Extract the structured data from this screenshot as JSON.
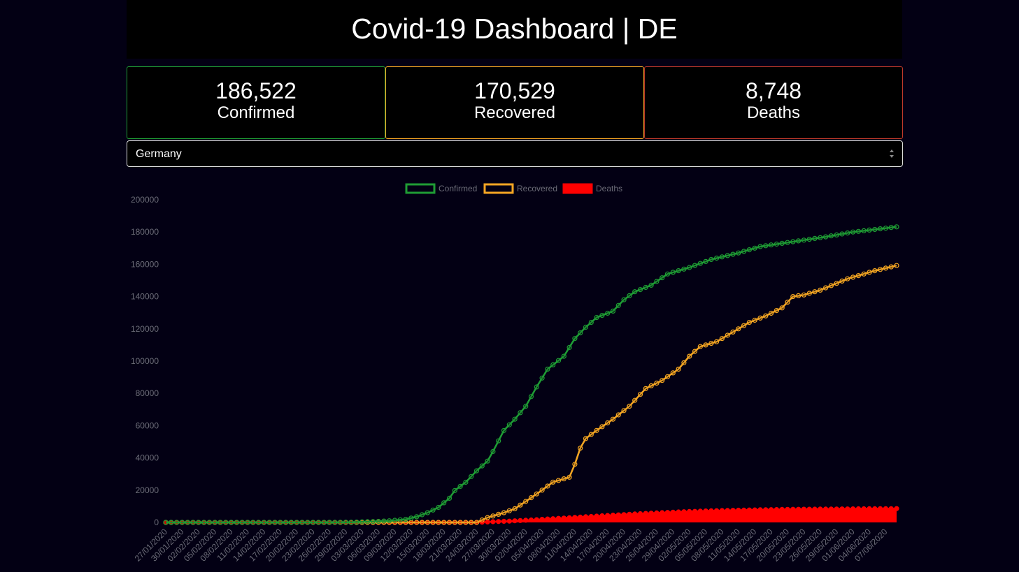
{
  "header": {
    "title": "Covid-19 Dashboard | DE"
  },
  "stats": [
    {
      "value": "186,522",
      "label": "Confirmed",
      "color": "#1f9d35"
    },
    {
      "value": "170,529",
      "label": "Recovered",
      "color": "#f5a623"
    },
    {
      "value": "8,748",
      "label": "Deaths",
      "color": "#c0392b"
    }
  ],
  "country_select": {
    "selected": "Germany"
  },
  "chart_data": {
    "type": "line",
    "x_start": "27/01/2020",
    "x_end": "09/06/2020",
    "x_tick_labels": [
      "27/01/2020",
      "30/01/2020",
      "02/02/2020",
      "05/02/2020",
      "08/02/2020",
      "11/02/2020",
      "14/02/2020",
      "17/02/2020",
      "20/02/2020",
      "23/02/2020",
      "26/02/2020",
      "29/02/2020",
      "03/03/2020",
      "06/03/2020",
      "09/03/2020",
      "12/03/2020",
      "15/03/2020",
      "18/03/2020",
      "21/03/2020",
      "24/03/2020",
      "27/03/2020",
      "30/03/2020",
      "02/04/2020",
      "05/04/2020",
      "08/04/2020",
      "11/04/2020",
      "14/04/2020",
      "17/04/2020",
      "20/04/2020",
      "23/04/2020",
      "26/04/2020",
      "29/04/2020",
      "02/05/2020",
      "05/05/2020",
      "08/05/2020",
      "11/05/2020",
      "14/05/2020",
      "17/05/2020",
      "20/05/2020",
      "23/05/2020",
      "26/05/2020",
      "29/05/2020",
      "01/06/2020",
      "04/06/2020",
      "07/06/2020"
    ],
    "y_ticks": [
      0,
      20000,
      40000,
      60000,
      80000,
      100000,
      120000,
      140000,
      160000,
      180000,
      200000
    ],
    "ylim": [
      0,
      200000
    ],
    "series": [
      {
        "name": "Confirmed",
        "color": "#1f9d35",
        "fill": false,
        "points": [
          [
            "27/01/2020",
            0
          ],
          [
            "25/02/2020",
            0
          ],
          [
            "01/03/2020",
            150
          ],
          [
            "05/03/2020",
            500
          ],
          [
            "08/03/2020",
            1000
          ],
          [
            "11/03/2020",
            1900
          ],
          [
            "13/03/2020",
            3500
          ],
          [
            "15/03/2020",
            6000
          ],
          [
            "17/03/2020",
            9300
          ],
          [
            "19/03/2020",
            15000
          ],
          [
            "20/03/2020",
            19800
          ],
          [
            "22/03/2020",
            24900
          ],
          [
            "24/03/2020",
            32000
          ],
          [
            "26/03/2020",
            38000
          ],
          [
            "27/03/2020",
            44000
          ],
          [
            "29/03/2020",
            57000
          ],
          [
            "31/03/2020",
            64000
          ],
          [
            "02/04/2020",
            72000
          ],
          [
            "04/04/2020",
            84000
          ],
          [
            "06/04/2020",
            95000
          ],
          [
            "09/04/2020",
            103000
          ],
          [
            "11/04/2020",
            114000
          ],
          [
            "13/04/2020",
            121000
          ],
          [
            "15/04/2020",
            127000
          ],
          [
            "18/04/2020",
            131000
          ],
          [
            "20/04/2020",
            138000
          ],
          [
            "22/04/2020",
            143000
          ],
          [
            "25/04/2020",
            147000
          ],
          [
            "28/04/2020",
            154000
          ],
          [
            "02/05/2020",
            158000
          ],
          [
            "06/05/2020",
            163000
          ],
          [
            "11/05/2020",
            167000
          ],
          [
            "15/05/2020",
            171000
          ],
          [
            "21/05/2020",
            174000
          ],
          [
            "27/05/2020",
            177000
          ],
          [
            "01/06/2020",
            180000
          ],
          [
            "06/06/2020",
            182000
          ],
          [
            "11/06/2020",
            184000
          ],
          [
            "17/06/2020",
            186522
          ]
        ]
      },
      {
        "name": "Recovered",
        "color": "#f5a623",
        "fill": false,
        "points": [
          [
            "27/01/2020",
            0
          ],
          [
            "24/03/2020",
            0
          ],
          [
            "26/03/2020",
            3000
          ],
          [
            "29/03/2020",
            6000
          ],
          [
            "31/03/2020",
            8500
          ],
          [
            "02/04/2020",
            13000
          ],
          [
            "05/04/2020",
            20000
          ],
          [
            "07/04/2020",
            25000
          ],
          [
            "10/04/2020",
            28000
          ],
          [
            "11/04/2020",
            36000
          ],
          [
            "12/04/2020",
            46000
          ],
          [
            "13/04/2020",
            52000
          ],
          [
            "15/04/2020",
            57000
          ],
          [
            "18/04/2020",
            64000
          ],
          [
            "21/04/2020",
            72000
          ],
          [
            "24/04/2020",
            83000
          ],
          [
            "27/04/2020",
            88000
          ],
          [
            "30/04/2020",
            95000
          ],
          [
            "02/05/2020",
            103000
          ],
          [
            "04/05/2020",
            109000
          ],
          [
            "07/05/2020",
            112000
          ],
          [
            "10/05/2020",
            118000
          ],
          [
            "13/05/2020",
            124000
          ],
          [
            "16/05/2020",
            128000
          ],
          [
            "19/05/2020",
            133000
          ],
          [
            "21/05/2020",
            140000
          ],
          [
            "23/05/2020",
            141000
          ],
          [
            "26/05/2020",
            144000
          ],
          [
            "31/05/2020",
            151000
          ],
          [
            "05/06/2020",
            156000
          ],
          [
            "10/06/2020",
            160000
          ],
          [
            "15/06/2020",
            164000
          ],
          [
            "20/06/2020",
            167000
          ],
          [
            "24/06/2020",
            170529
          ]
        ]
      },
      {
        "name": "Deaths",
        "color": "#ff0000",
        "fill": true,
        "points": [
          [
            "27/01/2020",
            0
          ],
          [
            "24/03/2020",
            0
          ],
          [
            "26/03/2020",
            300
          ],
          [
            "30/03/2020",
            800
          ],
          [
            "03/04/2020",
            1500
          ],
          [
            "07/04/2020",
            2300
          ],
          [
            "12/04/2020",
            3300
          ],
          [
            "18/04/2020",
            4500
          ],
          [
            "24/04/2020",
            5600
          ],
          [
            "30/04/2020",
            6500
          ],
          [
            "06/05/2020",
            7200
          ],
          [
            "13/05/2020",
            7700
          ],
          [
            "20/05/2020",
            8100
          ],
          [
            "28/05/2020",
            8300
          ],
          [
            "05/06/2020",
            8500
          ],
          [
            "15/06/2020",
            8650
          ],
          [
            "24/06/2020",
            8748
          ]
        ]
      }
    ],
    "legend_position": "top"
  }
}
